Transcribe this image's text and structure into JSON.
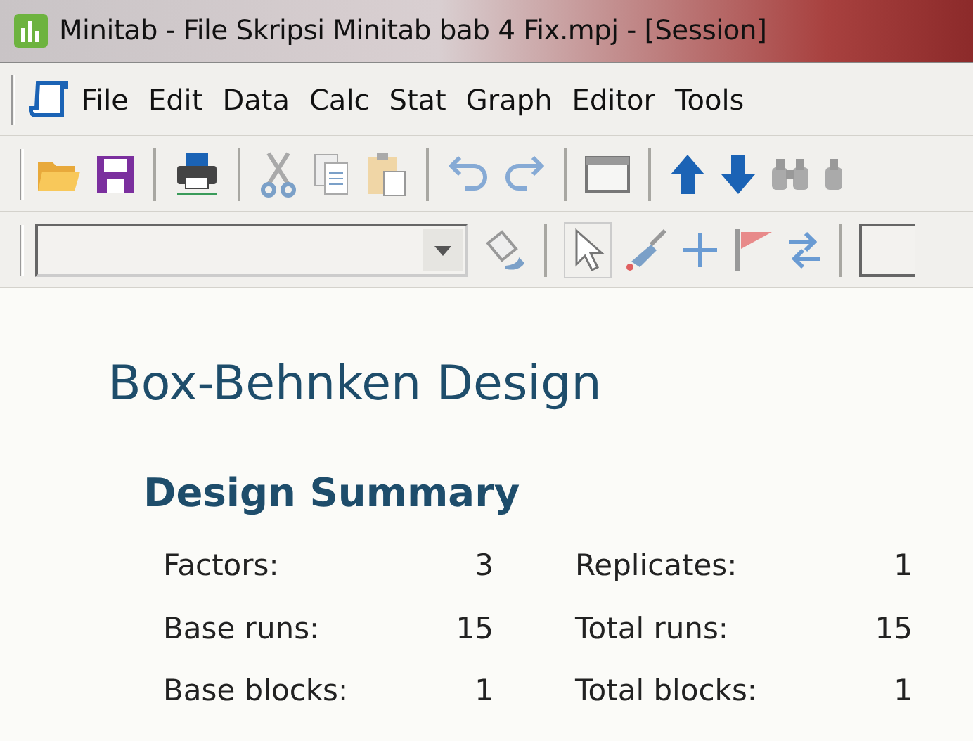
{
  "window": {
    "title": "Minitab - File Skripsi Minitab bab 4 Fix.mpj - [Session]"
  },
  "menu": [
    "File",
    "Edit",
    "Data",
    "Calc",
    "Stat",
    "Graph",
    "Editor",
    "Tools"
  ],
  "session": {
    "heading": "Box-Behnken Design",
    "subheading": "Design Summary",
    "summary": [
      {
        "label": "Factors:",
        "value": "3",
        "label_2": "Replicates:",
        "value_2": "1"
      },
      {
        "label": "Base runs:",
        "value": "15",
        "label_2": "Total runs:",
        "value_2": "15"
      },
      {
        "label": "Base blocks:",
        "value": "1",
        "label_2": "Total blocks:",
        "value_2": "1"
      }
    ]
  }
}
